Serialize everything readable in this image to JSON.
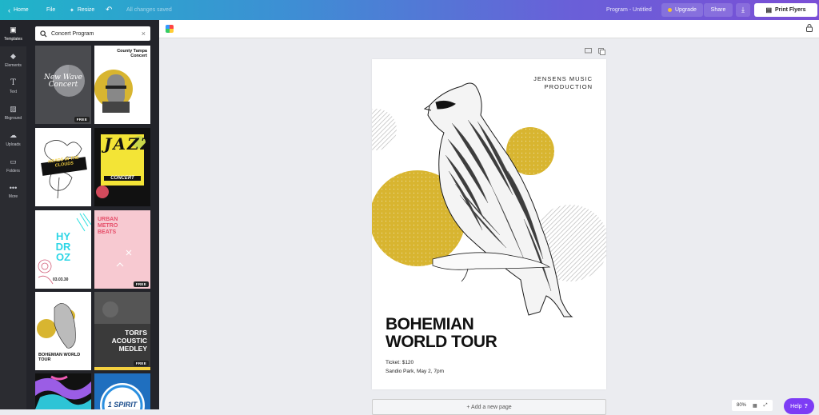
{
  "topbar": {
    "home": "Home",
    "file": "File",
    "resize": "Resize",
    "status": "All changes saved",
    "doc_title": "Program - Untitled",
    "upgrade": "Upgrade",
    "share": "Share",
    "print": "Print Flyers"
  },
  "rail": [
    {
      "label": "Templates",
      "icon": "templates-icon"
    },
    {
      "label": "Elements",
      "icon": "elements-icon"
    },
    {
      "label": "Text",
      "icon": "text-icon"
    },
    {
      "label": "Bkground",
      "icon": "background-icon"
    },
    {
      "label": "Uploads",
      "icon": "uploads-icon"
    },
    {
      "label": "Folders",
      "icon": "folders-icon"
    },
    {
      "label": "More",
      "icon": "more-icon"
    }
  ],
  "search": {
    "value": "Concert Program"
  },
  "templates": {
    "free_badge": "FREE",
    "t1": {
      "title": "New Wave Concert"
    },
    "t2": {
      "title": "County Tampa Concert"
    },
    "t3": {
      "title": "HEADS IN THE CLOUDS"
    },
    "t4": {
      "title": "JAZZ",
      "subtitle": "CONCERT"
    },
    "t5": {
      "title": "HY DR OZ",
      "date": "03.03.30"
    },
    "t6": {
      "title": "URBAN METRO BEATS"
    },
    "t7": {
      "title": "BOHEMIAN WORLD TOUR"
    },
    "t8": {
      "title": "TORI'S ACOUSTIC MEDLEY"
    },
    "t10": {
      "title": "1 SPIRIT"
    }
  },
  "poster": {
    "producer_line1": "JENSENS MUSIC",
    "producer_line2": "PRODUCTION",
    "title_line1": "BOHEMIAN",
    "title_line2": "WORLD TOUR",
    "ticket": "Ticket: $120",
    "venue": "Sandio Park, May 2, 7pm"
  },
  "add_page": "+ Add a new page",
  "zoom": {
    "level": "80%"
  },
  "help": "Help",
  "colors": {
    "accent_yellow": "#d8b530",
    "help_purple": "#7d3cf5",
    "panel": "#23242a"
  }
}
